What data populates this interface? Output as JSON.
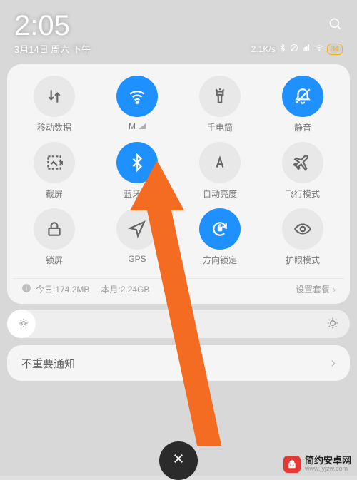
{
  "status": {
    "time": "2:05",
    "date": "3月14日 周六 下午",
    "speed": "2.1K/s",
    "battery": "34"
  },
  "toggles": [
    {
      "label": "移动数据",
      "icon": "data-swap",
      "active": false,
      "signal": false
    },
    {
      "label": "M",
      "icon": "wifi",
      "active": true,
      "signal": true
    },
    {
      "label": "手电筒",
      "icon": "flashlight",
      "active": false,
      "signal": false
    },
    {
      "label": "静音",
      "icon": "mute",
      "active": true,
      "signal": false
    },
    {
      "label": "截屏",
      "icon": "screenshot",
      "active": false,
      "signal": false
    },
    {
      "label": "蓝牙",
      "icon": "bluetooth",
      "active": true,
      "signal": true
    },
    {
      "label": "自动亮度",
      "icon": "auto-brightness",
      "active": false,
      "signal": false
    },
    {
      "label": "飞行模式",
      "icon": "airplane",
      "active": false,
      "signal": false
    },
    {
      "label": "锁屏",
      "icon": "lock",
      "active": false,
      "signal": false
    },
    {
      "label": "GPS",
      "icon": "gps",
      "active": false,
      "signal": false
    },
    {
      "label": "方向锁定",
      "icon": "rotation-lock",
      "active": true,
      "signal": false
    },
    {
      "label": "护眼模式",
      "icon": "eyecare",
      "active": false,
      "signal": false
    }
  ],
  "usage": {
    "today_label": "今日:174.2MB",
    "month_label": "本月:2.24GB",
    "plan_label": "设置套餐"
  },
  "notif": {
    "unimportant": "不重要通知"
  },
  "watermark": {
    "title": "简约安卓网",
    "url": "www.jyjzw.com"
  }
}
